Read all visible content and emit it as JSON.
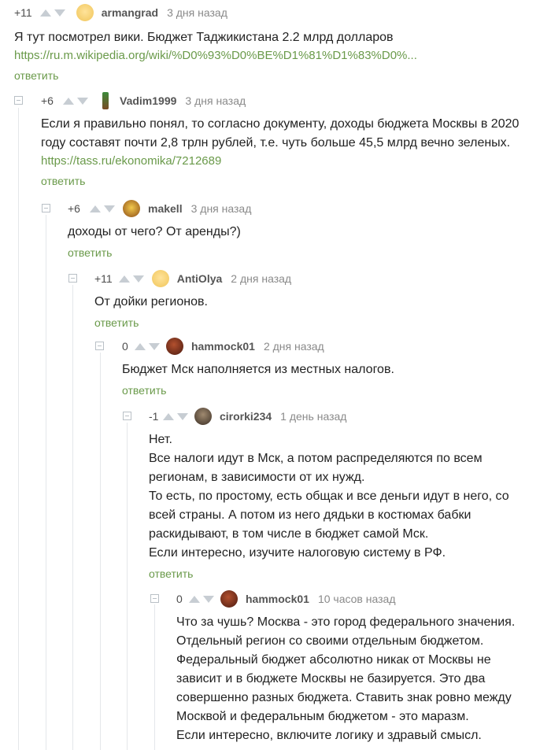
{
  "comments": [
    {
      "score": "+11",
      "user": "armangrad",
      "date": "3 дня назад",
      "lines": [
        "Я тут посмотрел вики. Бюджет Таджикистана 2.2 млрд долларов"
      ],
      "link": "https://ru.m.wikipedia.org/wiki/%D0%93%D0%BE%D1%81%D1%83%D0%...",
      "reply": "ответить"
    },
    {
      "score": "+6",
      "user": "Vadim1999",
      "date": "3 дня назад",
      "lines": [
        "Если я правильно понял, то согласно документу, доходы бюджета Москвы в 2020",
        "году составят почти 2,8 трлн рублей, т.е. чуть больше 45,5 млрд вечно зеленых."
      ],
      "link": "https://tass.ru/ekonomika/7212689",
      "reply": "ответить"
    },
    {
      "score": "+6",
      "user": "makell",
      "date": "3 дня назад",
      "lines": [
        "доходы от чего? От аренды?)"
      ],
      "reply": "ответить"
    },
    {
      "score": "+11",
      "user": "AntiOlya",
      "date": "2 дня назад",
      "lines": [
        "От дойки регионов."
      ],
      "reply": "ответить"
    },
    {
      "score": "0",
      "user": "hammock01",
      "date": "2 дня назад",
      "lines": [
        "Бюджет Мск наполняется из местных налогов."
      ],
      "reply": "ответить"
    },
    {
      "score": "-1",
      "user": "cirorki234",
      "date": "1 день назад",
      "lines": [
        "Нет.",
        "Все налоги идут в Мск, а потом распределяются по всем",
        "регионам, в зависимости от их нужд.",
        "То есть, по простому, есть общак и все деньги идут в него, со",
        "всей страны. А потом из него дядьки в костюмах бабки",
        "раскидывают, в том числе в бюджет самой Мск.",
        "Если интересно, изучите налоговую систему в РФ."
      ],
      "reply": "ответить"
    },
    {
      "score": "0",
      "user": "hammock01",
      "date": "10 часов назад",
      "lines": [
        "Что за чушь? Москва - это город федерального значения.",
        "Отдельный регион со своими отдельным бюджетом.",
        "Федеральный бюджет абсолютно никак от Москвы не",
        "зависит и в бюджете Москвы не базируется. Это два",
        "совершенно разных бюджета. Ставить знак ровно между",
        "Москвой и федеральным бюджетом - это маразм.",
        "Если интересно, включите логику и здравый смысл."
      ]
    }
  ]
}
